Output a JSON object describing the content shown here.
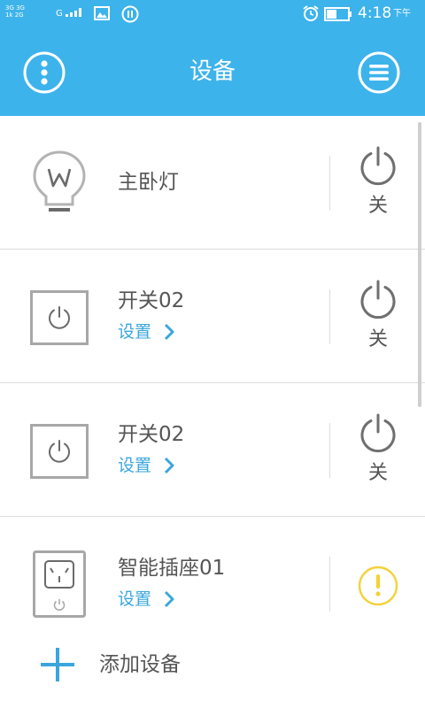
{
  "status_bar": {
    "net_line1": "3G 3G",
    "net_line2": "1k 2G",
    "signal_label": "G",
    "time": "4:18",
    "ampm": "下午"
  },
  "app_bar": {
    "title": "设备",
    "menu_icon": "more-vertical-icon",
    "list_icon": "list-menu-icon",
    "color": "#3db3ec"
  },
  "devices": [
    {
      "name": "主卧灯",
      "icon": "light-bulb-icon",
      "settings_label": "",
      "state_label": "关",
      "status": "off"
    },
    {
      "name": "开关02",
      "icon": "wall-switch-icon",
      "settings_label": "设置",
      "state_label": "关",
      "status": "off"
    },
    {
      "name": "开关02",
      "icon": "wall-switch-icon",
      "settings_label": "设置",
      "state_label": "关",
      "status": "off"
    },
    {
      "name": "智能插座01",
      "icon": "smart-socket-icon",
      "settings_label": "设置",
      "state_label": "",
      "status": "warning"
    }
  ],
  "add_device": {
    "label": "添加设备",
    "icon": "plus-icon"
  },
  "colors": {
    "accent": "#3aa6dd",
    "warning": "#f2d23a",
    "power_icon": "#6f6f6f"
  }
}
